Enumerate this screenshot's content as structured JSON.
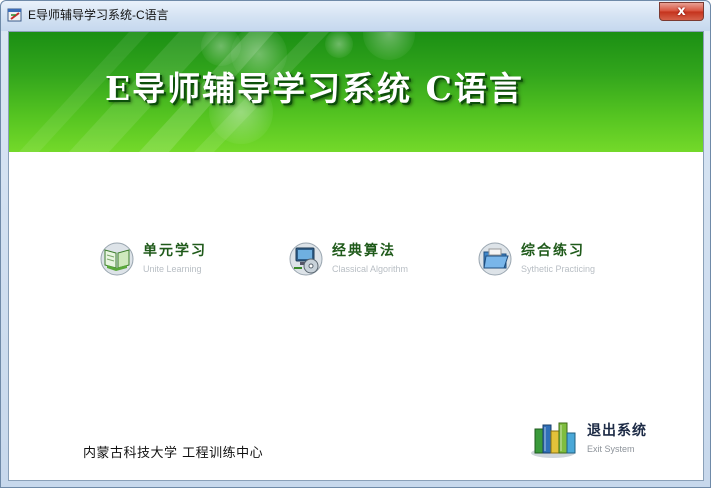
{
  "window": {
    "title": "E导师辅导学习系统-C语言",
    "close_glyph": "x"
  },
  "banner": {
    "title": "E导师辅导学习系统   C语言"
  },
  "menu": {
    "unit_learning": {
      "cn": "单元学习",
      "en": "Unite Learning",
      "icon": "open-book-icon"
    },
    "classical_algorithm": {
      "cn": "经典算法",
      "en": "Classical Algorithm",
      "icon": "computer-cd-icon"
    },
    "synthetic_practicing": {
      "cn": "综合练习",
      "en": "Sythetic Practicing",
      "icon": "folder-icon"
    }
  },
  "exit": {
    "cn": "退出系统",
    "en": "Exit System",
    "icon": "books-icon"
  },
  "footer": {
    "text": "内蒙古科技大学  工程训练中心"
  },
  "colors": {
    "banner_green": "#32a51c",
    "menu_text": "#1f5a1a",
    "close_red": "#c4321c"
  }
}
